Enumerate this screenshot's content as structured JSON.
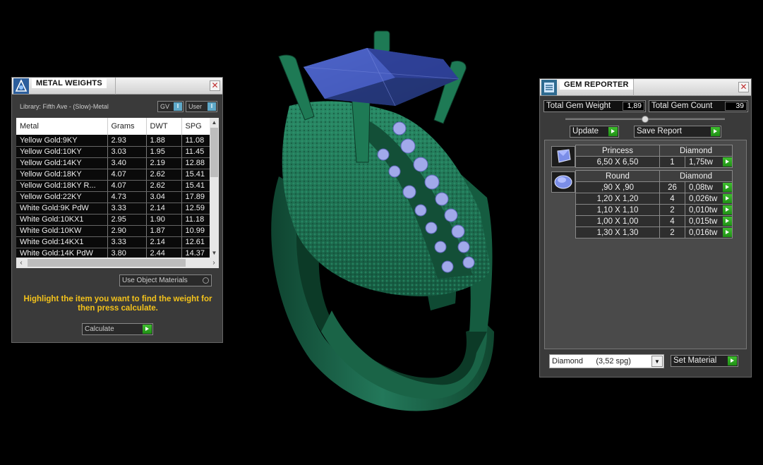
{
  "metal_weights": {
    "title": "METAL WEIGHTS",
    "library_label": "Library: Fifth Ave - (Slow)-Metal",
    "toggles": [
      {
        "label": "GV",
        "indicator": "I"
      },
      {
        "label": "User",
        "indicator": "I"
      }
    ],
    "columns": [
      "Metal",
      "Grams",
      "DWT",
      "SPG"
    ],
    "rows": [
      [
        "Yellow Gold:9KY",
        "2.93",
        "1.88",
        "11.08"
      ],
      [
        "Yellow Gold:10KY",
        "3.03",
        "1.95",
        "11.45"
      ],
      [
        "Yellow Gold:14KY",
        "3.40",
        "2.19",
        "12.88"
      ],
      [
        "Yellow Gold:18KY",
        "4.07",
        "2.62",
        "15.41"
      ],
      [
        "Yellow Gold:18KY R...",
        "4.07",
        "2.62",
        "15.41"
      ],
      [
        "Yellow Gold:22KY",
        "4.73",
        "3.04",
        "17.89"
      ],
      [
        "White Gold:9K PdW",
        "3.33",
        "2.14",
        "12.59"
      ],
      [
        "White Gold:10KX1",
        "2.95",
        "1.90",
        "11.18"
      ],
      [
        "White Gold:10KW",
        "2.90",
        "1.87",
        "10.99"
      ],
      [
        "White Gold:14KX1",
        "3.33",
        "2.14",
        "12.61"
      ],
      [
        "White Gold:14K PdW",
        "3.80",
        "2.44",
        "14.37"
      ]
    ],
    "use_object_materials": "Use Object Materials",
    "hint": "Highlight the item you want to find the weight for then press calculate.",
    "calculate": "Calculate"
  },
  "gem_reporter": {
    "title": "GEM REPORTER",
    "total_weight_label": "Total Gem Weight",
    "total_weight_value": "1,89",
    "total_count_label": "Total Gem Count",
    "total_count_value": "39",
    "update": "Update",
    "save_report": "Save Report",
    "groups": [
      {
        "shape": "Princess",
        "material": "Diamond",
        "items": [
          {
            "size": "6,50 X 6,50",
            "count": "1",
            "weight": "1,75tw"
          }
        ]
      },
      {
        "shape": "Round",
        "material": "Diamond",
        "items": [
          {
            "size": ",90 X ,90",
            "count": "26",
            "weight": "0,08tw"
          },
          {
            "size": "1,20 X 1,20",
            "count": "4",
            "weight": "0,026tw"
          },
          {
            "size": "1,10 X 1,10",
            "count": "2",
            "weight": "0,010tw"
          },
          {
            "size": "1,00 X 1,00",
            "count": "4",
            "weight": "0,015tw"
          },
          {
            "size": "1,30 X 1,30",
            "count": "2",
            "weight": "0,016tw"
          }
        ]
      }
    ],
    "material_select": "Diamond      (3,52 spg)",
    "set_material": "Set Material"
  },
  "colors": {
    "ring_green": "#1e6e4d",
    "gem_blue": "#3b52a8",
    "small_gem": "#9fa7e6",
    "hint_yellow": "#f3c21b",
    "go_green": "#2fa821"
  }
}
